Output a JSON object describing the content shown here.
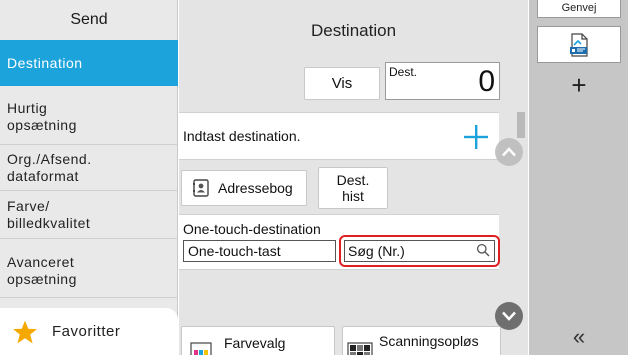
{
  "sidebar": {
    "title": "Send",
    "items": [
      {
        "label": "Destination"
      },
      {
        "label": "Hurtig\nopsætning"
      },
      {
        "label": "Org./Afsend.\ndataformat"
      },
      {
        "label": "Farve/\nbilledkvalitet"
      },
      {
        "label": "Avanceret\nopsætning"
      }
    ],
    "favorites_label": "Favoritter"
  },
  "main": {
    "title": "Destination",
    "vis_label": "Vis",
    "dest_count_label": "Dest.",
    "dest_count_value": "0",
    "enter_destination_label": "Indtast destination.",
    "address_book_label": "Adressebog",
    "dest_history_label": "Dest.\nhist",
    "one_touch": {
      "heading": "One-touch-destination",
      "key_label": "One-touch-tast",
      "search_label": "Søg (Nr.)"
    },
    "color_select_label": "Farvevalg",
    "scan_resolution_label": "Scanningsopløs"
  },
  "shortcut": {
    "tab_label": "Genvej",
    "add_symbol": "+",
    "collapse_symbol": "«"
  },
  "colors": {
    "accent": "#1da3dc",
    "highlight_border": "#e02020",
    "star": "#f5a800"
  }
}
